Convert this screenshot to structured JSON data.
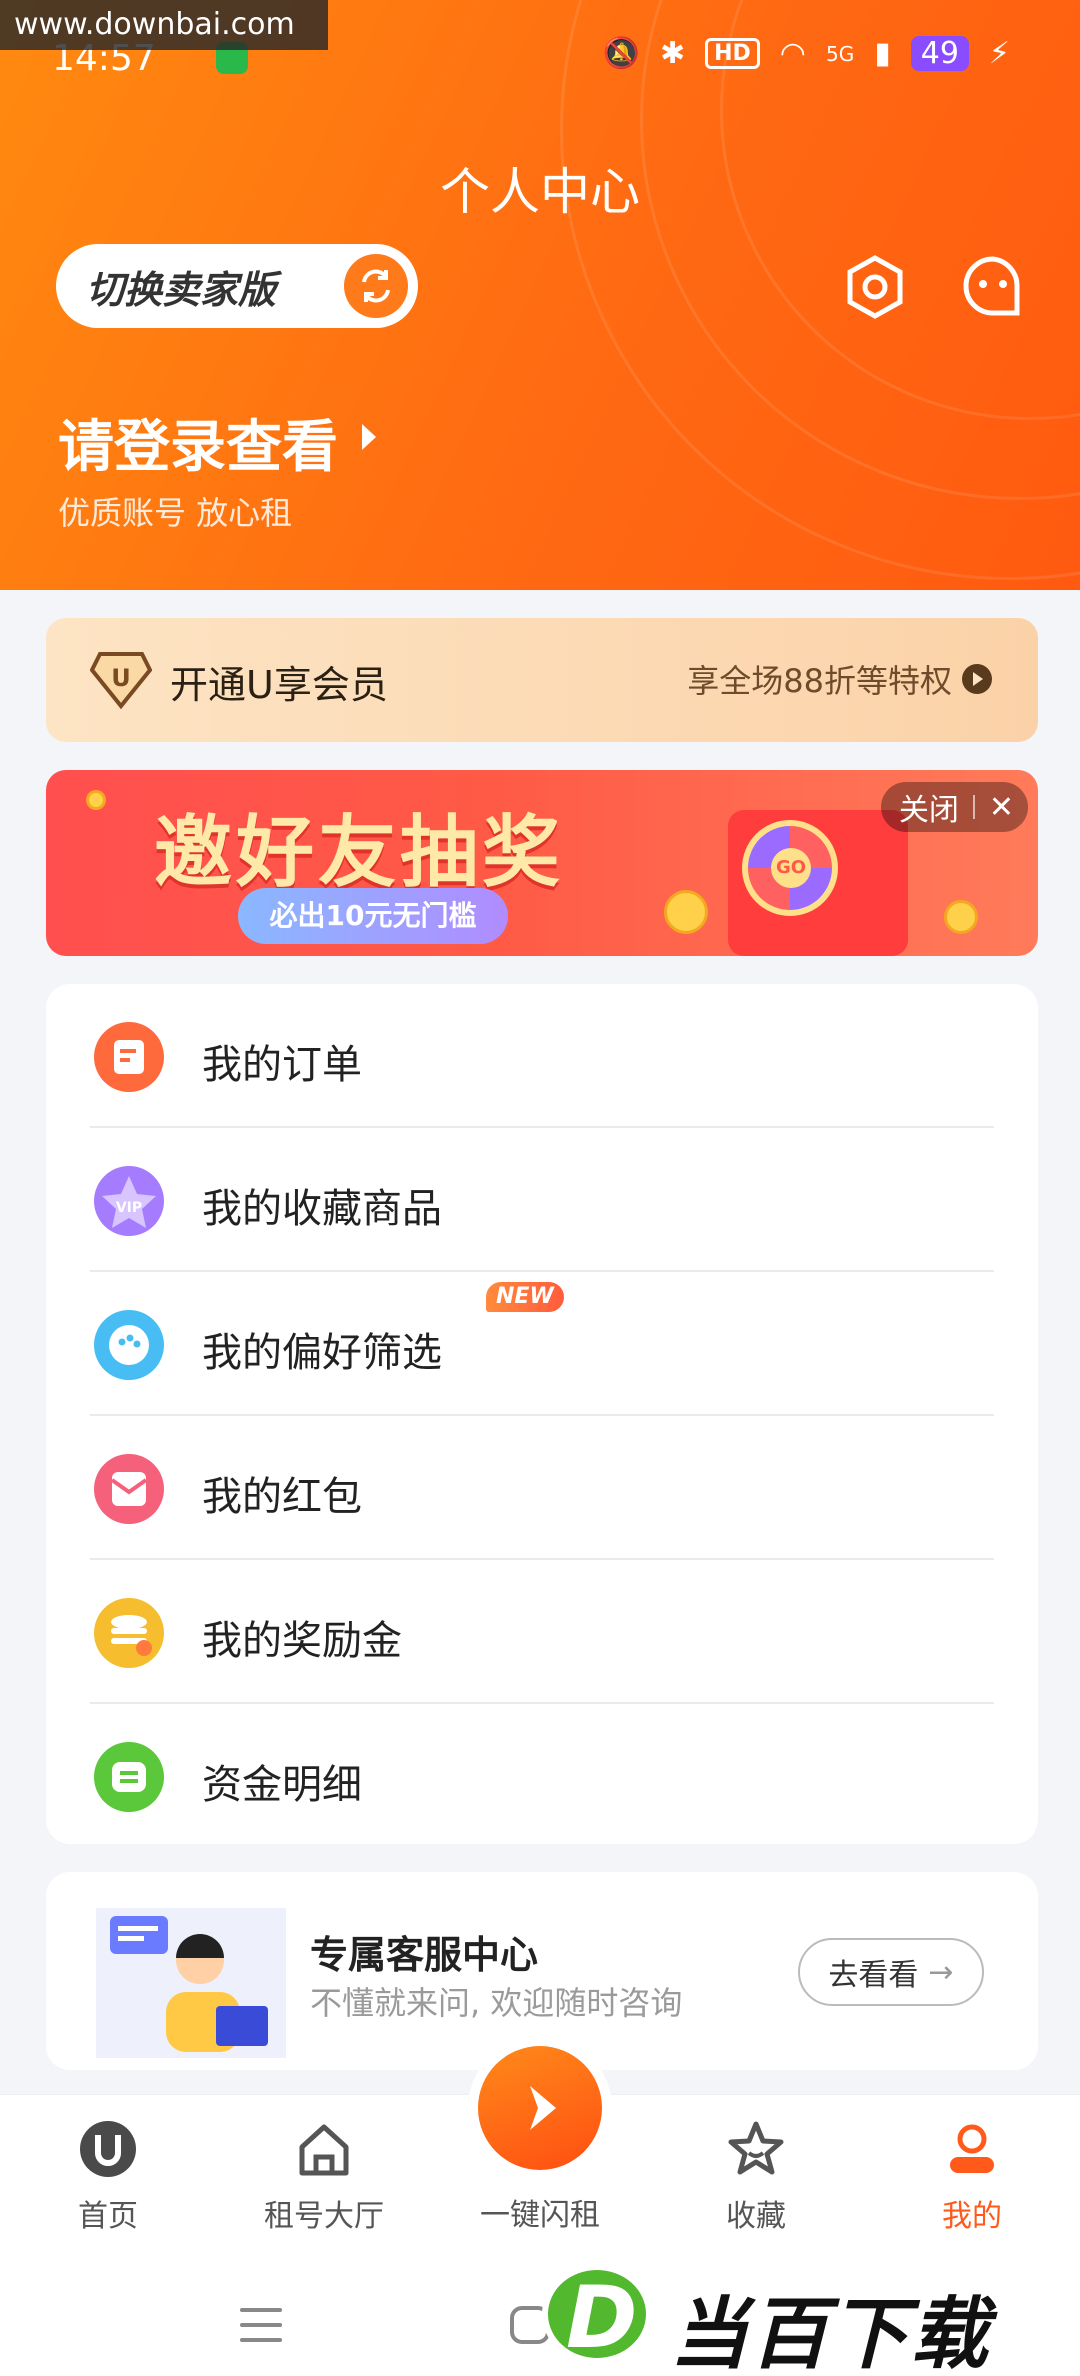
{
  "watermark": "www.downbai.com",
  "status_bar": {
    "time": "14:57",
    "hd": "HD",
    "network": "5G",
    "battery": "49"
  },
  "header": {
    "title": "个人中心",
    "switch_label": "切换卖家版",
    "login_title": "请登录查看",
    "login_subtitle": "优质账号 放心租",
    "settings_icon": "settings-hexagon-icon",
    "message_icon": "chat-bubble-icon"
  },
  "member": {
    "title": "开通U享会员",
    "benefit": "享全场88折等特权"
  },
  "banner": {
    "headline": "邀好友抽奖",
    "pill": "必出10元无门槛",
    "close": "关闭",
    "close_x": "✕",
    "wheel_label": "GO"
  },
  "menu": {
    "items": [
      {
        "label": "我的订单",
        "icon": "order-icon",
        "color": "#ff6a3c"
      },
      {
        "label": "我的收藏商品",
        "icon": "vip-star-icon",
        "color": "#9b6bff"
      },
      {
        "label": "我的偏好筛选",
        "icon": "preference-bubble-icon",
        "color": "#3fb6f0",
        "badge": "NEW"
      },
      {
        "label": "我的红包",
        "icon": "red-envelope-icon",
        "color": "#f5607a"
      },
      {
        "label": "我的奖励金",
        "icon": "coin-stack-icon",
        "color": "#f5b82a"
      },
      {
        "label": "资金明细",
        "icon": "fund-detail-icon",
        "color": "#5ac83a"
      }
    ]
  },
  "service": {
    "title": "专属客服中心",
    "subtitle": "不懂就来问, 欢迎随时咨询",
    "button": "去看看",
    "arrow": "→"
  },
  "tabbar": {
    "items": [
      {
        "label": "首页",
        "icon": "home-u-icon"
      },
      {
        "label": "租号大厅",
        "icon": "house-icon"
      },
      {
        "label": "收藏",
        "icon": "star-icon"
      },
      {
        "label": "我的",
        "icon": "profile-icon"
      }
    ],
    "fab_label": "一键闪租",
    "active_color": "#ff5a1a"
  },
  "brand": {
    "d": "D",
    "text": "当百下载"
  }
}
